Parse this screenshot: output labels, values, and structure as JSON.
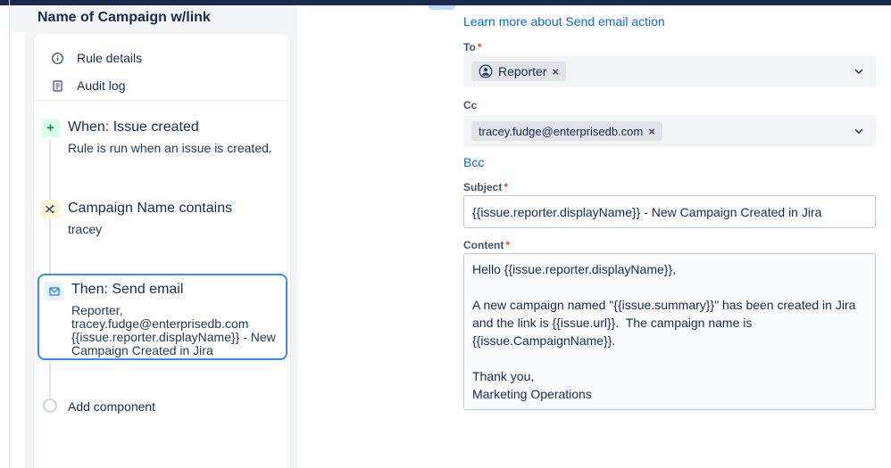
{
  "sidebar": {
    "title": "Name of Campaign w/link",
    "nav_items": [
      {
        "label": "Rule details",
        "icon": "info-icon"
      },
      {
        "label": "Audit log",
        "icon": "audit-log-icon"
      }
    ],
    "components": [
      {
        "kind": "trigger",
        "icon": "plus-icon",
        "plus_glyph": "+",
        "title": "When: Issue created",
        "description": "Rule is run when an issue is created."
      },
      {
        "kind": "condition",
        "icon": "shuffle-icon",
        "title": "Campaign Name contains",
        "description": "tracey"
      },
      {
        "kind": "action",
        "icon": "email-icon",
        "selected": true,
        "title": "Then: Send email",
        "description": "Reporter,\ntracey.fudge@enterprisedb.com\n{{issue.reporter.displayName}} - New\nCampaign Created in Jira"
      }
    ],
    "add_component_label": "Add component"
  },
  "panel": {
    "learn_more_link": "Learn more about Send email action",
    "to": {
      "label": "To",
      "required_mark": "*",
      "chip": "Reporter",
      "chip_icon": "person-icon"
    },
    "cc": {
      "label": "Cc",
      "chip": "tracey.fudge@enterprisedb.com"
    },
    "bcc_link": "Bcc",
    "subject": {
      "label": "Subject",
      "required_mark": "*",
      "value": "{{issue.reporter.displayName}} - New Campaign Created in Jira"
    },
    "content": {
      "label": "Content",
      "required_mark": "*",
      "value": "Hello {{issue.reporter.displayName}},\n\nA new campaign named \"{{issue.summary}}\" has been created in Jira and the link is {{issue.url}}.  The campaign name is {{issue.CampaignName}}.\n\nThank you,\nMarketing Operations"
    },
    "remove_chip_glyph": "×"
  },
  "colors": {
    "topbar": "#1C2B4D",
    "link_blue": "#0C66E4",
    "selected_border": "#388BFF",
    "required_red": "#E34935",
    "trigger_icon_bg": "#DCFDEE",
    "condition_icon_bg": "#FFF7D6",
    "action_icon_bg": "#E9F2FF"
  }
}
